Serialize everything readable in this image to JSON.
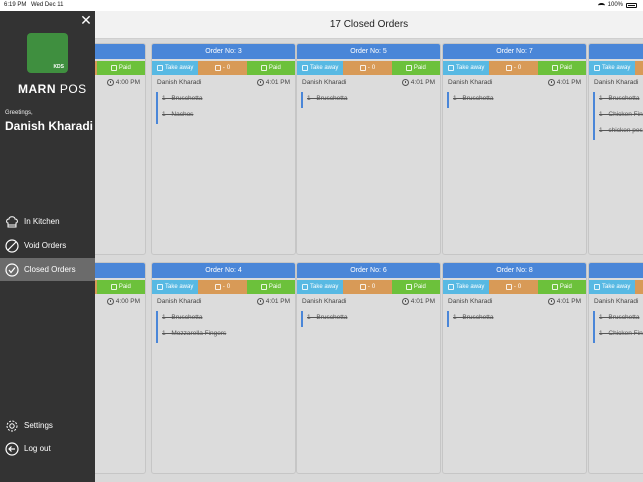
{
  "status_bar": {
    "time": "6:19 PM",
    "date": "Wed Dec 11",
    "battery": "100%"
  },
  "sidebar": {
    "logo_badge": "KDS",
    "brand_bold": "MARN",
    "brand_light": " POS",
    "greeting": "Greetings,",
    "user_name": "Danish Kharadi",
    "nav": [
      {
        "label": "In Kitchen",
        "icon": "chef-hat-icon"
      },
      {
        "label": "Void Orders",
        "icon": "no-entry-icon"
      },
      {
        "label": "Closed Orders",
        "icon": "check-circle-icon"
      },
      {
        "label": "Settings",
        "icon": "gear-icon"
      },
      {
        "label": "Log out",
        "icon": "logout-icon"
      }
    ]
  },
  "header": {
    "title": "17 Closed Orders"
  },
  "orders": [
    {
      "title": "",
      "type": "Take away",
      "price": "0",
      "status": "Paid",
      "customer": "Danish Kharadi",
      "time": "4:00 PM",
      "items": [
        "",
        "",
        ""
      ]
    },
    {
      "title": "Order No: 3",
      "type": "Take away",
      "price": "0",
      "status": "Paid",
      "customer": "Danish Kharadi",
      "time": "4:01 PM",
      "items": [
        "1 - Bruschetta",
        "1 - Nachos"
      ]
    },
    {
      "title": "Order No: 5",
      "type": "Take away",
      "price": "0",
      "status": "Paid",
      "customer": "Danish Kharadi",
      "time": "4:01 PM",
      "items": [
        "1 - Bruschetta"
      ]
    },
    {
      "title": "Order No: 7",
      "type": "Take away",
      "price": "0",
      "status": "Paid",
      "customer": "Danish Kharadi",
      "time": "4:01 PM",
      "items": [
        "1 - Bruschetta"
      ]
    },
    {
      "title": "O",
      "type": "Take away",
      "price": "",
      "status": "",
      "customer": "Danish Kharadi",
      "time": "",
      "items": [
        "1 - Bruschetta",
        "1 - Chicken Fing",
        "1 - chicken pes"
      ]
    },
    {
      "title": "",
      "type": "Take away",
      "price": "0",
      "status": "Paid",
      "customer": "Danish Kharadi",
      "time": "4:00 PM",
      "items": [
        "",
        ""
      ]
    },
    {
      "title": "Order No: 4",
      "type": "Take away",
      "price": "0",
      "status": "Paid",
      "customer": "Danish Kharadi",
      "time": "4:01 PM",
      "items": [
        "1 - Bruschetta",
        "1 - Mozzarella Fingers"
      ]
    },
    {
      "title": "Order No: 6",
      "type": "Take away",
      "price": "0",
      "status": "Paid",
      "customer": "Danish Kharadi",
      "time": "4:01 PM",
      "items": [
        "1 - Bruschetta"
      ]
    },
    {
      "title": "Order No: 8",
      "type": "Take away",
      "price": "0",
      "status": "Paid",
      "customer": "Danish Kharadi",
      "time": "4:01 PM",
      "items": [
        "1 - Bruschetta"
      ]
    },
    {
      "title": "O",
      "type": "Take away",
      "price": "",
      "status": "",
      "customer": "Danish Kharadi",
      "time": "",
      "items": [
        "1 - Bruschetta",
        "1 - Chicken Fing"
      ]
    }
  ],
  "colors": {
    "sidebar": "#333333",
    "header_blue": "#4a86d8",
    "take_away": "#58b9e3",
    "price": "#d89a57",
    "paid": "#6cc13b"
  }
}
